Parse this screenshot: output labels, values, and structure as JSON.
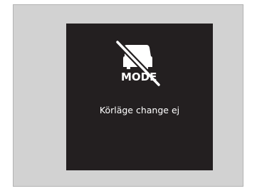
{
  "display": {
    "icon": "drive-mode-prohibited-icon",
    "mode_label": "MODE",
    "message": "Körläge change ej"
  },
  "colors": {
    "background": "#d2d2d2",
    "screen": "#231f20",
    "foreground": "#ffffff"
  }
}
